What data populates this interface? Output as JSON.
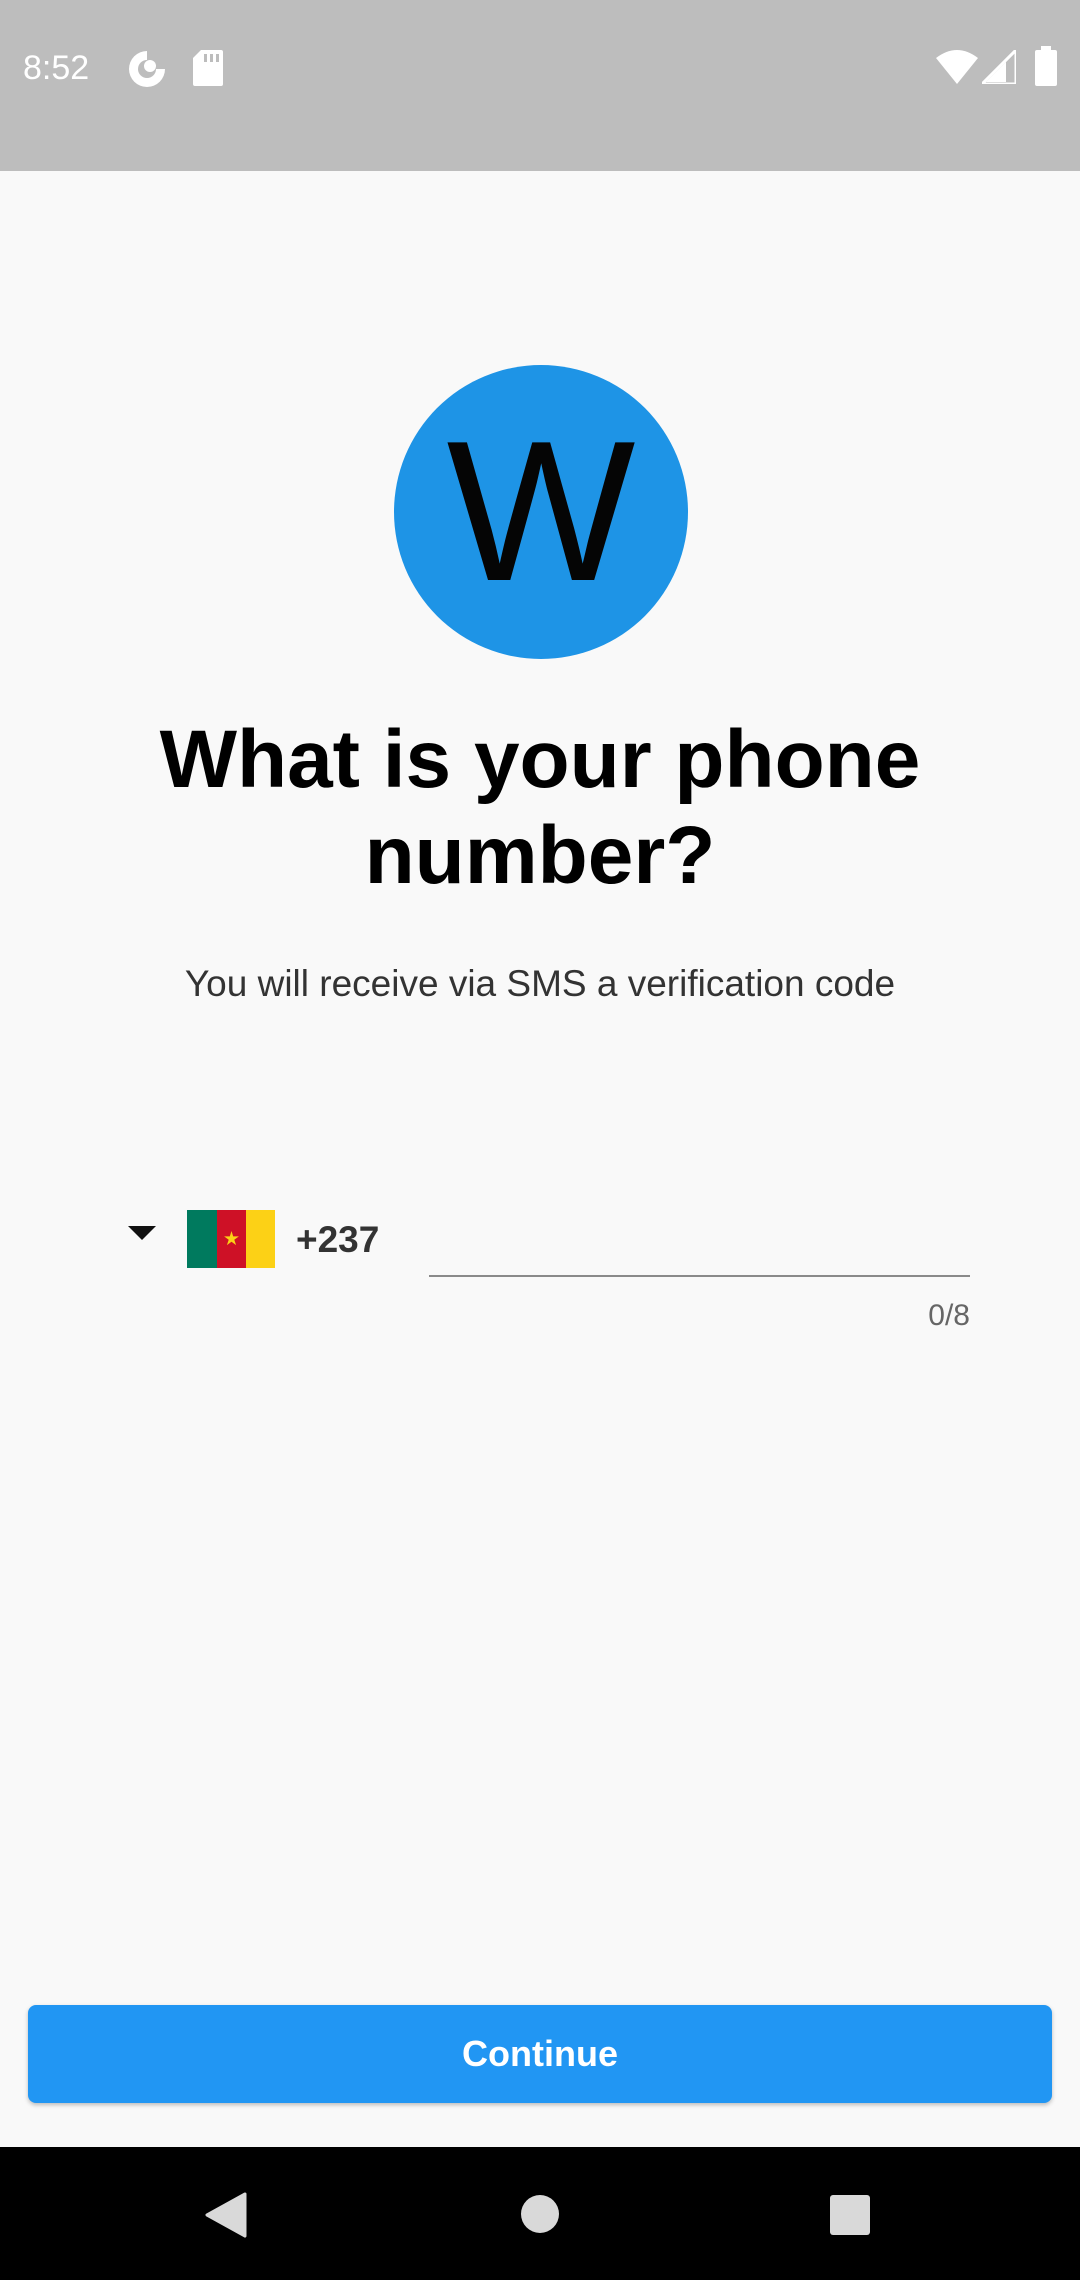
{
  "status_bar": {
    "time": "8:52",
    "icons": [
      "pocket-casts-icon",
      "sd-card-icon",
      "wifi-icon",
      "cell-signal-icon",
      "battery-icon"
    ]
  },
  "logo": {
    "letter": "W",
    "color": "#1e94e6"
  },
  "title": "What is your phone number?",
  "subtitle": "You will receive via SMS a verification code",
  "country_picker": {
    "dial_code": "+237",
    "flag_icon": "cameroon-flag-icon"
  },
  "phone_input": {
    "value": "",
    "placeholder": "",
    "counter": "0/8"
  },
  "continue_button": {
    "label": "Continue",
    "color": "#2196f3"
  },
  "nav_bar": {
    "icons": [
      "back-icon",
      "home-icon",
      "recents-icon"
    ]
  }
}
